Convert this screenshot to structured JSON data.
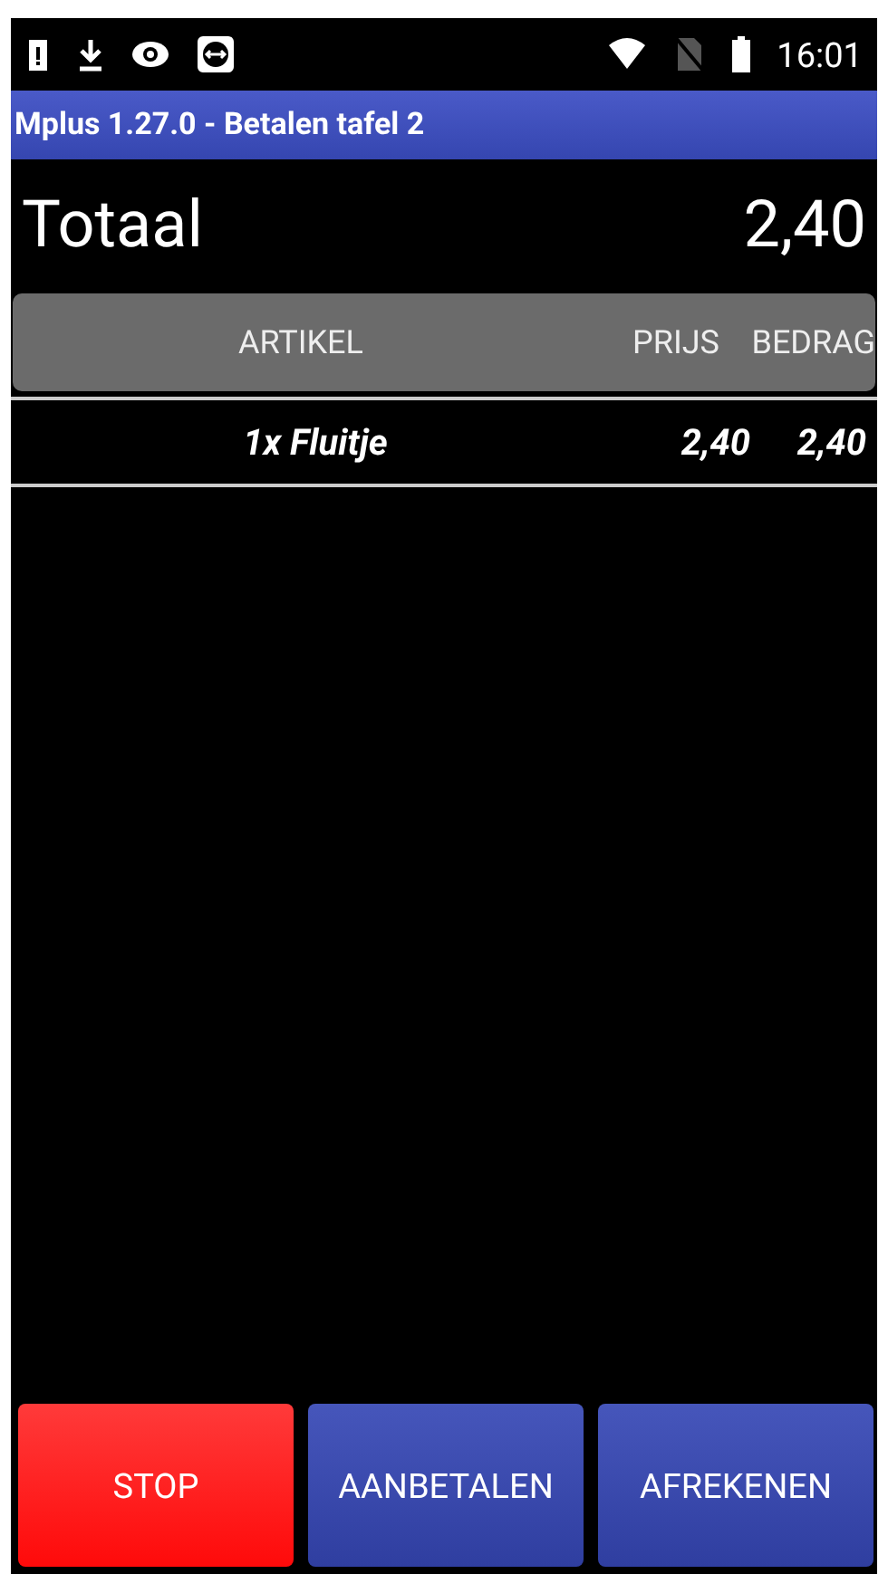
{
  "status_bar": {
    "time": "16:01"
  },
  "window": {
    "title": "Mplus 1.27.0 - Betalen tafel 2"
  },
  "total": {
    "label": "Totaal",
    "value": "2,40"
  },
  "table": {
    "columns": [
      "ARTIKEL",
      "PRIJS",
      "BEDRAG"
    ],
    "rows": [
      {
        "item": "1x Fluitje",
        "price": "2,40",
        "amount": "2,40"
      }
    ]
  },
  "buttons": [
    {
      "label": "STOP",
      "kind": "danger"
    },
    {
      "label": "AANBETALEN",
      "kind": "primary"
    },
    {
      "label": "AFREKENEN",
      "kind": "primary"
    }
  ]
}
